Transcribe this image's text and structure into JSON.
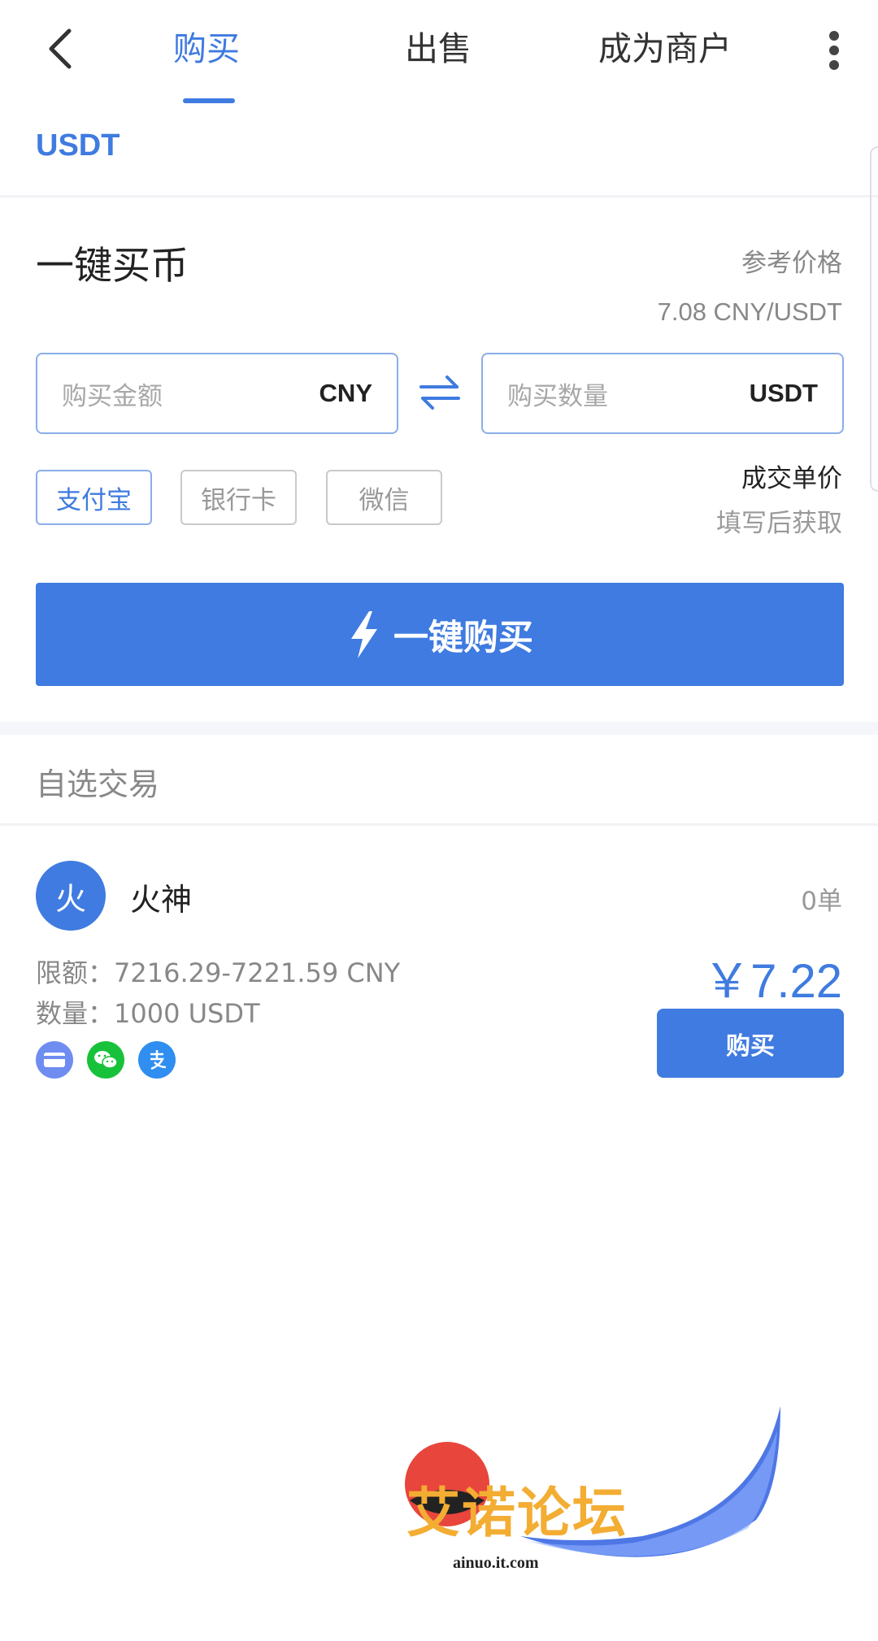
{
  "nav": {
    "tabs": [
      {
        "label": "购买",
        "active": true
      },
      {
        "label": "出售",
        "active": false
      },
      {
        "label": "成为商户",
        "active": false
      }
    ],
    "back_icon": "chevron-left-icon",
    "more_icon": "more-vertical-icon"
  },
  "coin_tab": "USDT",
  "quick_buy": {
    "title": "一键买币",
    "ref_label": "参考价格",
    "ref_price": "7.08 CNY/USDT",
    "amount_placeholder": "购买金额",
    "amount_unit": "CNY",
    "quantity_placeholder": "购买数量",
    "quantity_unit": "USDT",
    "payment_methods": [
      {
        "label": "支付宝",
        "selected": true
      },
      {
        "label": "银行卡",
        "selected": false
      },
      {
        "label": "微信",
        "selected": false
      }
    ],
    "unit_price_label": "成交单价",
    "unit_price_hint": "填写后获取",
    "button_label": "一键购买"
  },
  "favorites": {
    "title": "自选交易",
    "listings": [
      {
        "avatar_char": "火",
        "name": "火神",
        "orders": "0单",
        "limit": "限额：7216.29-7221.59 CNY",
        "quantity": "数量：1000 USDT",
        "price": "￥7.22",
        "buy_label": "购买",
        "payment_icons": [
          "bank-card-icon",
          "wechat-icon",
          "alipay-icon"
        ]
      }
    ]
  },
  "watermark": {
    "text": "艾诺论坛",
    "site": "ainuo.it.com"
  },
  "colors": {
    "accent": "#3f7be0",
    "wechat": "#17c23a",
    "card": "#6f8cf0",
    "watermark": "#f3ad33"
  }
}
